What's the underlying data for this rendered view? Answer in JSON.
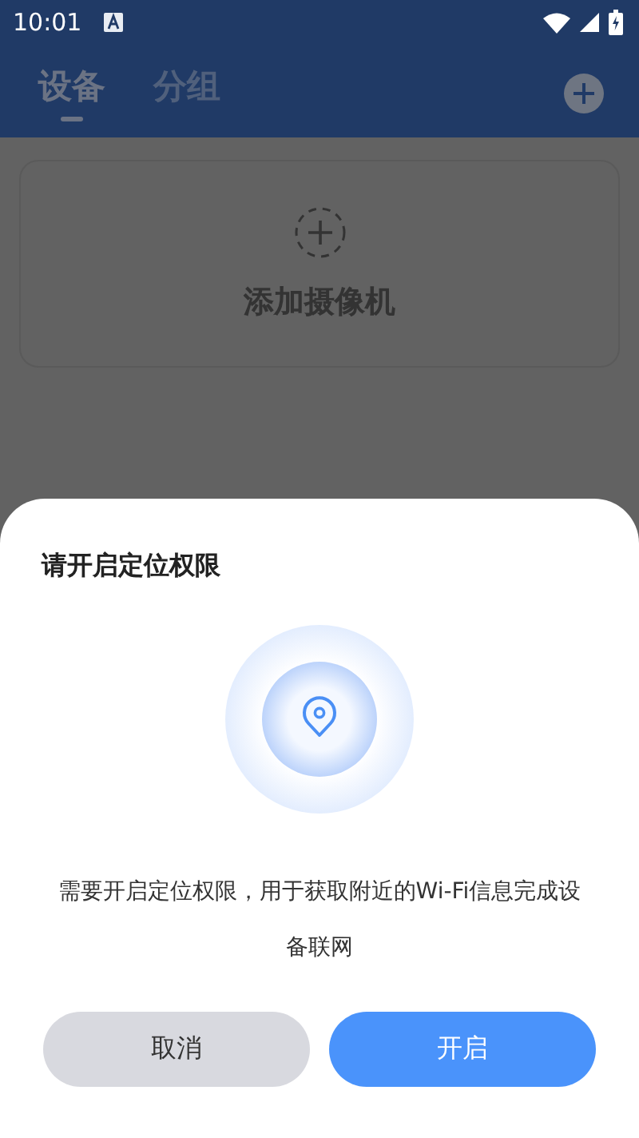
{
  "status_bar": {
    "time": "10:01"
  },
  "tabs": [
    {
      "label": "设备",
      "selected": true
    },
    {
      "label": "分组",
      "selected": false
    }
  ],
  "add_camera": {
    "label": "添加摄像机"
  },
  "dialog": {
    "title": "请开启定位权限",
    "message": "需要开启定位权限，用于获取附近的Wi-Fi信息完成设备联网",
    "buttons": [
      {
        "label": "取消",
        "kind": "secondary"
      },
      {
        "label": "开启",
        "kind": "primary"
      }
    ]
  }
}
